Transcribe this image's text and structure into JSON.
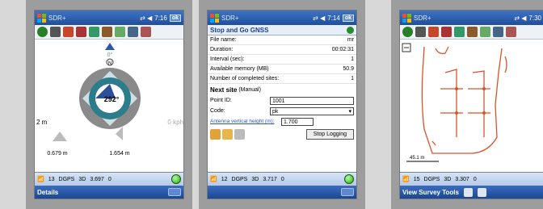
{
  "screens": [
    {
      "title_app": "SDR+",
      "time": "7:16",
      "ok": "ok",
      "compass_dir": "0°",
      "compass_n": "N",
      "bearing": "292°",
      "dist_left": "2 m",
      "speed": "0 kph",
      "offset_left": "0.679 m",
      "offset_right": "1.654 m",
      "status": {
        "sats": "13",
        "mode": "DGPS",
        "dim": "3D",
        "pdop": "3.697",
        "zero": "0"
      },
      "menu": "Details"
    },
    {
      "title_app": "SDR+",
      "time": "7:14",
      "ok": "ok",
      "form_title": "Stop and Go GNSS",
      "rows": [
        {
          "label": "File name:",
          "value": "mr"
        },
        {
          "label": "Duration:",
          "value": "00:02:31"
        },
        {
          "label": "Interval (sec):",
          "value": "1"
        },
        {
          "label": "Available memory (MB)",
          "value": "50.9"
        },
        {
          "label": "Number of completed sites:",
          "value": "1"
        }
      ],
      "next_site": "Next site",
      "next_mode": "(Manual)",
      "point_id_label": "Point ID:",
      "point_id": "1001",
      "code_label": "Code:",
      "code": "pk",
      "antenna_label": "Antenna vertical height (m):",
      "antenna": "1.700",
      "stop_label": "Stop Logging",
      "status": {
        "sats": "12",
        "mode": "DGPS",
        "dim": "3D",
        "pdop": "3.717",
        "zero": "0"
      }
    },
    {
      "title_app": "SDR+",
      "time": "7:30",
      "scale": "45.1 m",
      "status": {
        "sats": "15",
        "mode": "DGPS",
        "dim": "3D",
        "pdop": "3.307",
        "zero": "0"
      },
      "menu": "View Survey Tools"
    }
  ]
}
